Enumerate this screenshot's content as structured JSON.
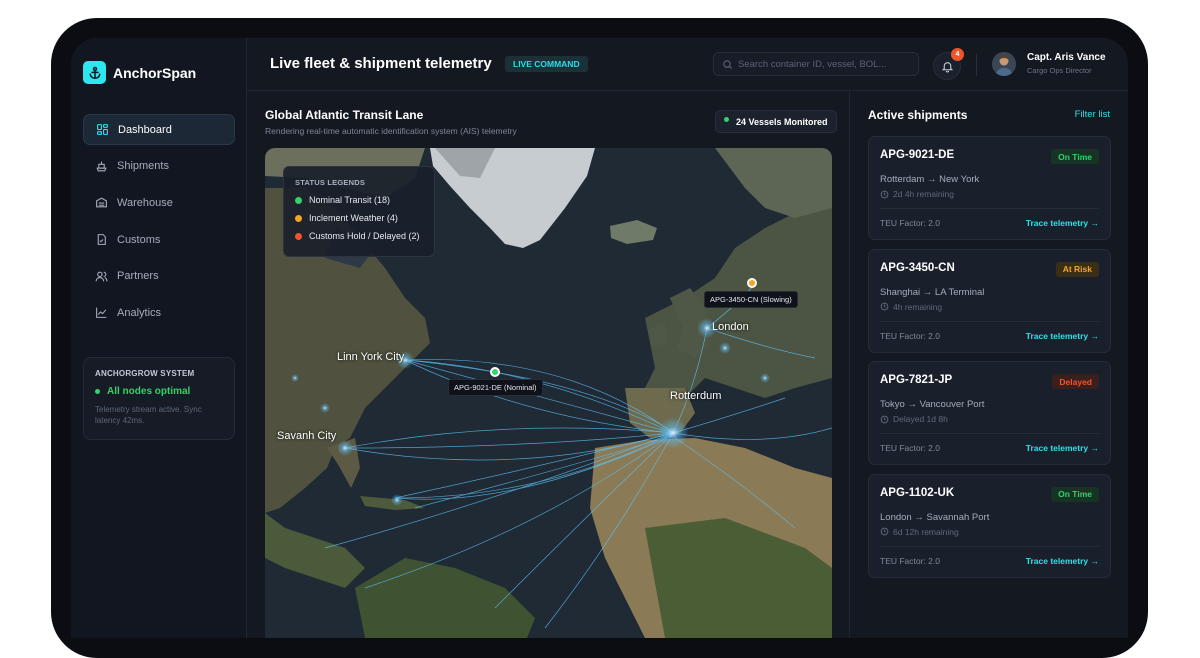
{
  "brand": {
    "name": "AnchorSpan"
  },
  "nav": [
    {
      "label": "Dashboard",
      "icon": "dashboard-icon",
      "active": true
    },
    {
      "label": "Shipments",
      "icon": "ship-icon"
    },
    {
      "label": "Warehouse",
      "icon": "warehouse-icon"
    },
    {
      "label": "Customs",
      "icon": "document-check-icon"
    },
    {
      "label": "Partners",
      "icon": "users-icon"
    },
    {
      "label": "Analytics",
      "icon": "chart-icon"
    }
  ],
  "system": {
    "title": "ANCHORGROW SYSTEM",
    "status": "All nodes optimal",
    "note": "Telemetry stream active. Sync latency 42ms."
  },
  "header": {
    "title": "Live fleet & shipment telemetry",
    "badge": "LIVE COMMAND",
    "search_placeholder": "Search container ID, vessel, BOL...",
    "notification_count": "4",
    "user_name": "Capt. Aris Vance",
    "user_role": "Cargo Ops Director"
  },
  "map": {
    "title": "Global Atlantic Transit Lane",
    "subtitle": "Rendering real-time automatic identification system (AIS) telemetry",
    "vessels": "24 Vessels Monitored",
    "legend_title": "STATUS LEGENDS",
    "legend": [
      {
        "label": "Nominal Transit (18)",
        "color": "#34d26a"
      },
      {
        "label": "Inclement Weather (4)",
        "color": "#f5a524"
      },
      {
        "label": "Customs Hold / Delayed (2)",
        "color": "#f0542b"
      }
    ],
    "cities": [
      "Linn York City",
      "Savanh City",
      "Rotterdum",
      "London"
    ],
    "tags": [
      "APG-9021-DE (Nominal)",
      "APG-3450-CN (Slowing)"
    ]
  },
  "shipments": {
    "title": "Active shipments",
    "filter": "Filter list",
    "items": [
      {
        "id": "APG-9021-DE",
        "status": "On Time",
        "status_color": "#34d26a",
        "status_bg": "#173324",
        "route": "Rotterdam → New York",
        "eta": "2d 4h remaining",
        "teu": "TEU Factor: 2.0",
        "action": "Trace telemetry →"
      },
      {
        "id": "APG-3450-CN",
        "status": "At Risk",
        "status_color": "#f5a524",
        "status_bg": "#3a2e17",
        "route": "Shanghai → LA Terminal",
        "eta": "4h remaining",
        "teu": "TEU Factor: 2.0",
        "action": "Trace telemetry →"
      },
      {
        "id": "APG-7821-JP",
        "status": "Delayed",
        "status_color": "#f0542b",
        "status_bg": "#3a1f1c",
        "route": "Tokyo → Vancouver Port",
        "eta": "Delayed 1d 8h",
        "teu": "TEU Factor: 2.0",
        "action": "Trace telemetry →"
      },
      {
        "id": "APG-1102-UK",
        "status": "On Time",
        "status_color": "#34d26a",
        "status_bg": "#173324",
        "route": "London → Savannah Port",
        "eta": "6d 12h remaining",
        "teu": "TEU Factor: 2.0",
        "action": "Trace telemetry →"
      }
    ]
  },
  "colors": {
    "accent": "#2ee6f0",
    "background": "#141821"
  }
}
